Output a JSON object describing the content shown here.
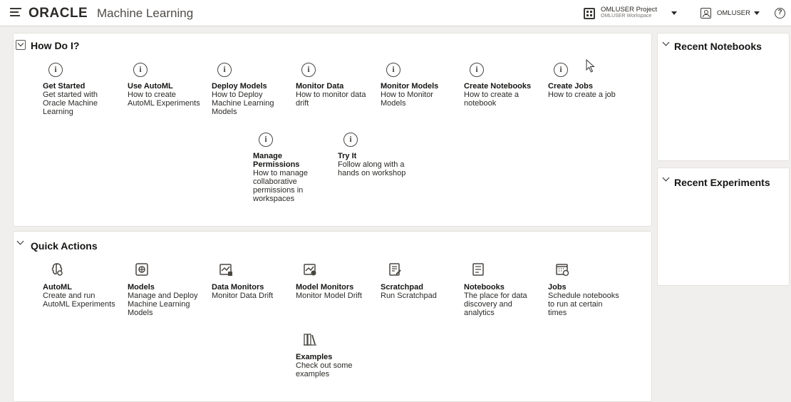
{
  "header": {
    "brand": "ORACLE",
    "app_name": "Machine Learning",
    "project_name": "OMLUSER Project",
    "workspace_name": "OMLUSER Workspace",
    "user_name": "OMLUSER",
    "help_glyph": "?"
  },
  "how_do_i": {
    "title": "How Do I?",
    "items": [
      {
        "title": "Get Started",
        "desc": [
          "Get started with",
          "Oracle Machine",
          "Learning"
        ]
      },
      {
        "title": "Use AutoML",
        "desc": [
          "How to create",
          "AutoML Experiments"
        ]
      },
      {
        "title": "Deploy Models",
        "desc": [
          "How to Deploy",
          "Machine Learning",
          "Models"
        ]
      },
      {
        "title": "Monitor Data",
        "desc": [
          "How to monitor data",
          "drift"
        ]
      },
      {
        "title": "Monitor Models",
        "desc": [
          "How to Monitor",
          "Models"
        ]
      },
      {
        "title": "Create Notebooks",
        "desc": [
          "How to create a",
          "notebook"
        ]
      },
      {
        "title": "Create Jobs",
        "desc": [
          "How to create a job"
        ]
      },
      {
        "title": [
          "Manage",
          "Permissions"
        ],
        "desc": [
          "How to manage",
          "collaborative",
          "permissions in",
          "workspaces"
        ]
      },
      {
        "title": "Try It",
        "desc": [
          "Follow along with a",
          "hands on workshop"
        ]
      }
    ]
  },
  "quick_actions": {
    "title": "Quick Actions",
    "items": [
      {
        "title": "AutoML",
        "desc": [
          "Create and run",
          "AutoML Experiments"
        ],
        "icon": "automl-icon"
      },
      {
        "title": "Models",
        "desc": [
          "Manage and Deploy",
          "Machine Learning",
          "Models"
        ],
        "icon": "models-icon"
      },
      {
        "title": "Data Monitors",
        "desc": [
          "Monitor Data Drift"
        ],
        "icon": "data-monitor-icon"
      },
      {
        "title": "Model Monitors",
        "desc": [
          "Monitor Model Drift"
        ],
        "icon": "model-monitor-icon"
      },
      {
        "title": "Scratchpad",
        "desc": [
          "Run Scratchpad"
        ],
        "icon": "scratchpad-icon"
      },
      {
        "title": "Notebooks",
        "desc": [
          "The place for data",
          "discovery and",
          "analytics"
        ],
        "icon": "notebook-icon"
      },
      {
        "title": "Jobs",
        "desc": [
          "Schedule notebooks",
          "to run at certain",
          "times"
        ],
        "icon": "jobs-icon"
      },
      {
        "title": "Examples",
        "desc": [
          "Check out some",
          "examples"
        ],
        "icon": "examples-icon"
      }
    ]
  },
  "recent_notebooks": {
    "title": "Recent Notebooks"
  },
  "recent_experiments": {
    "title": "Recent Experiments"
  }
}
